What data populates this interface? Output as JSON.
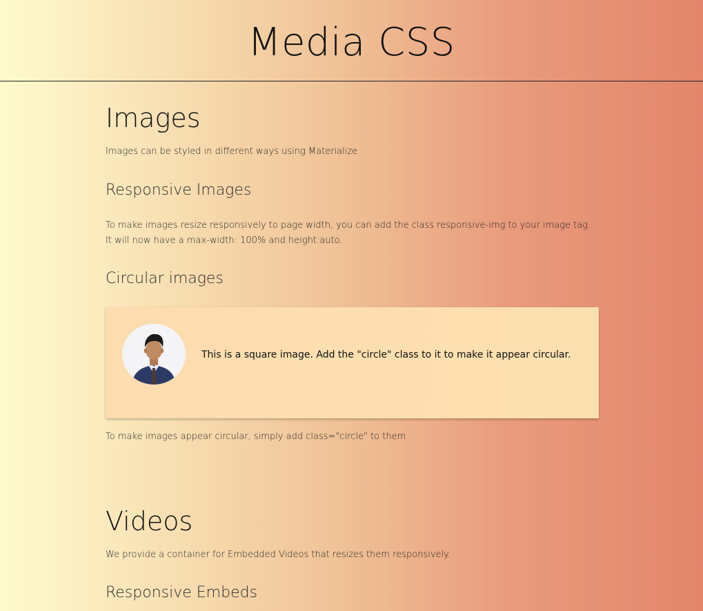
{
  "page": {
    "title": "Media CSS"
  },
  "images_section": {
    "heading": "Images",
    "intro": "Images can be styled in different ways using Materialize",
    "responsive": {
      "heading": "Responsive Images",
      "description": "To make images resize responsively to page width, you can add the class responsive-img to your image tag. It will now have a max-width: 100% and height:auto."
    },
    "circular": {
      "heading": "Circular images",
      "card_text": "This is a square image. Add the \"circle\" class to it to make it appear circular.",
      "avatar_icon": "person-portrait",
      "note": "To make images appear circular, simply add class=\"circle\" to them"
    }
  },
  "videos_section": {
    "heading": "Videos",
    "intro": "We provide a container for Embedded Videos that resizes them responsively.",
    "responsive_embeds": {
      "heading": "Responsive Embeds"
    }
  },
  "colors": {
    "gradient_left": "#fffacc",
    "gradient_right": "#e3856b",
    "card_bg": "#fde0b0"
  }
}
